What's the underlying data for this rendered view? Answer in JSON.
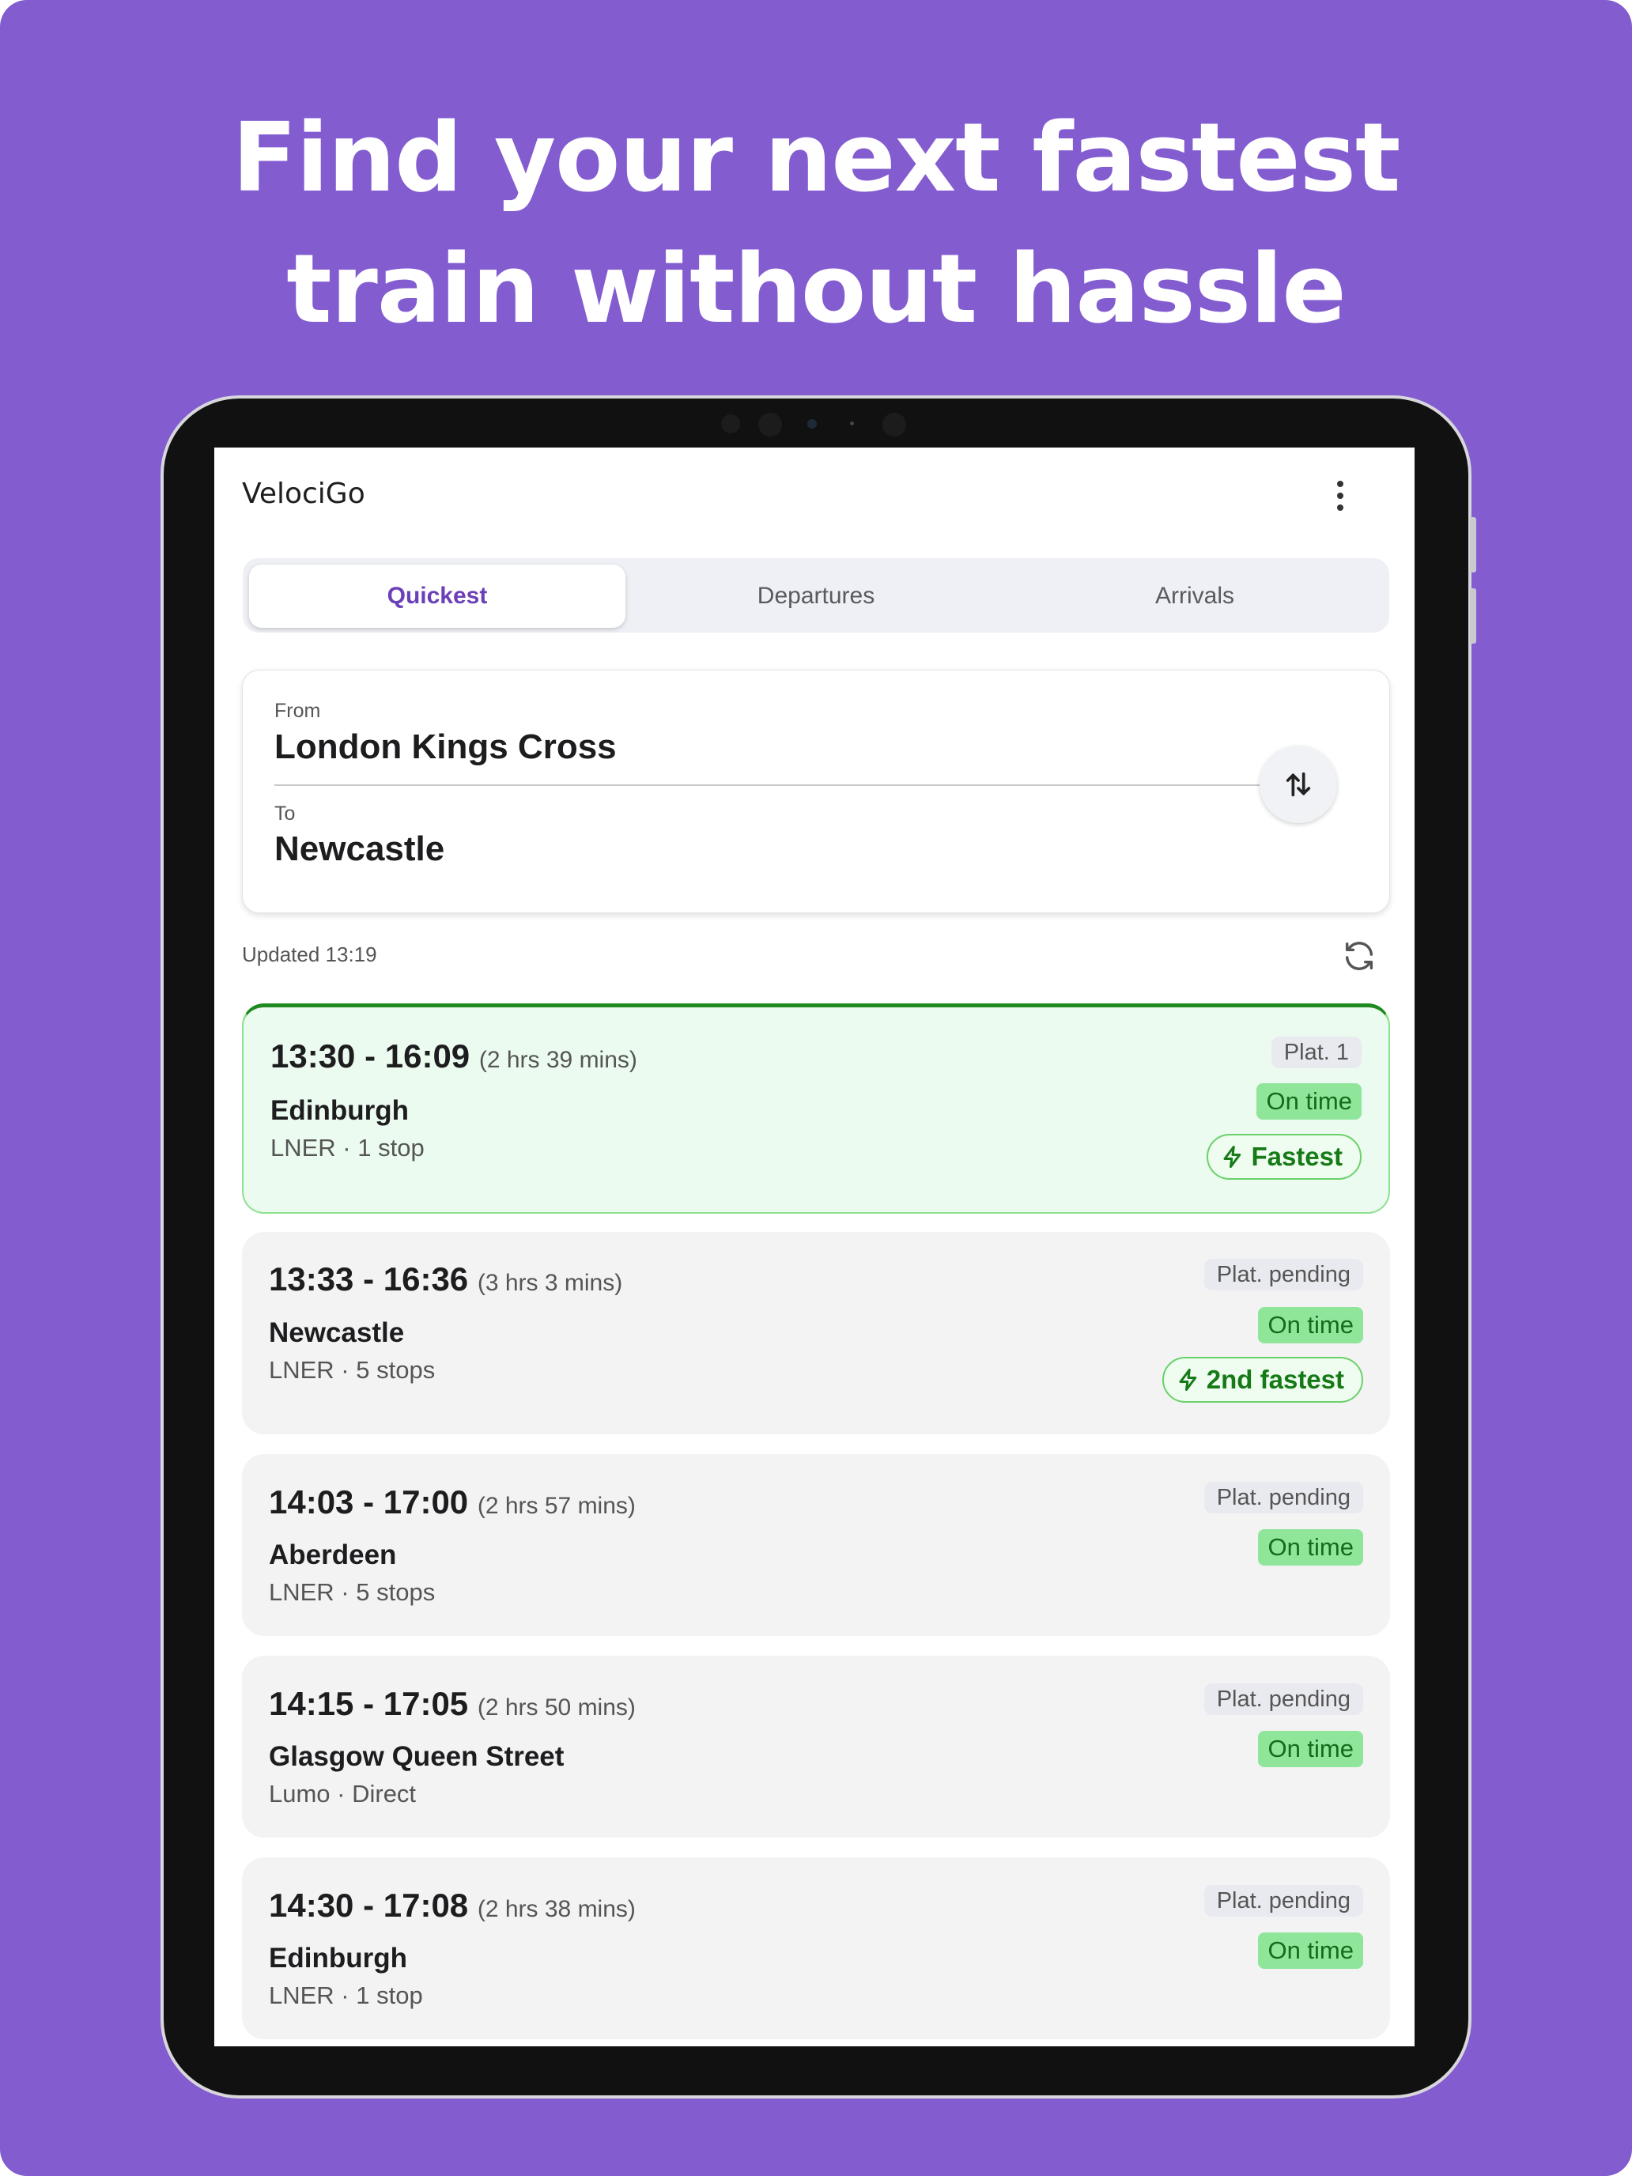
{
  "headline": {
    "line1": "Find your next fastest",
    "line2": "train without hassle"
  },
  "app": {
    "title": "VelociGo",
    "menu_icon": "more-vertical-icon"
  },
  "tabs": [
    {
      "label": "Quickest",
      "active": true
    },
    {
      "label": "Departures",
      "active": false
    },
    {
      "label": "Arrivals",
      "active": false
    }
  ],
  "route": {
    "from_label": "From",
    "from_value": "London Kings Cross",
    "to_label": "To",
    "to_value": "Newcastle",
    "swap_icon": "swap-vertical-icon"
  },
  "status_bar": {
    "updated": "Updated 13:19",
    "refresh_icon": "refresh-icon"
  },
  "trains": [
    {
      "times": "13:30 - 16:09",
      "duration": "(2 hrs 39 mins)",
      "destination": "Edinburgh",
      "meta": "LNER · 1 stop",
      "platform": "Plat. 1",
      "status": "On time",
      "rank": "Fastest"
    },
    {
      "times": "13:33 - 16:36",
      "duration": "(3 hrs 3 mins)",
      "destination": "Newcastle",
      "meta": "LNER · 5 stops",
      "platform": "Plat. pending",
      "status": "On time",
      "rank": "2nd fastest"
    },
    {
      "times": "14:03 - 17:00",
      "duration": "(2 hrs 57 mins)",
      "destination": "Aberdeen",
      "meta": "LNER · 5 stops",
      "platform": "Plat. pending",
      "status": "On time"
    },
    {
      "times": "14:15 - 17:05",
      "duration": "(2 hrs 50 mins)",
      "destination": "Glasgow Queen Street",
      "meta": "Lumo · Direct",
      "platform": "Plat. pending",
      "status": "On time"
    },
    {
      "times": "14:30 - 17:08",
      "duration": "(2 hrs 38 mins)",
      "destination": "Edinburgh",
      "meta": "LNER · 1 stop",
      "platform": "Plat. pending",
      "status": "On time"
    }
  ],
  "colors": {
    "background": "#835CD0",
    "accent": "#6B3FB8",
    "fastest_border": "#1F8A1F",
    "on_time": "#8FE59A"
  }
}
